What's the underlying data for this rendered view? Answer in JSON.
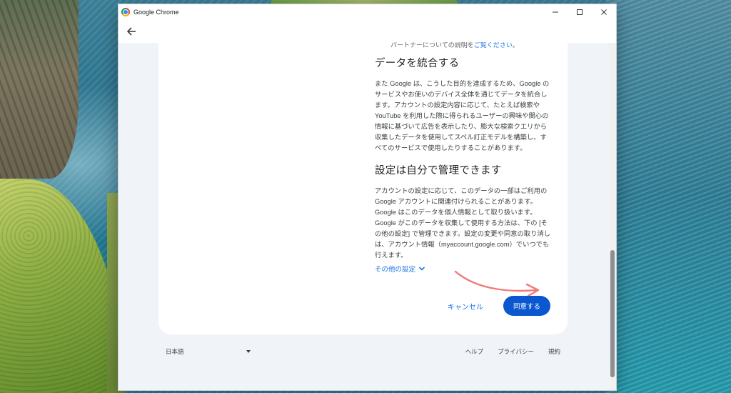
{
  "window": {
    "title": "Google Chrome",
    "controls": {
      "minimize": "—",
      "maximize": "☐",
      "close": "✕"
    }
  },
  "consent": {
    "cut_line_text": "パートナーについての説明を",
    "cut_line_link": "ご覧ください",
    "cut_line_tail": "。",
    "section1_title": "データを統合する",
    "section1_body": "また Google は、こうした目的を達成するため、Google のサービスやお使いのデバイス全体を通じてデータを統合します。アカウントの設定内容に応じて、たとえば検索や YouTube を利用した際に得られるユーザーの興味や関心の情報に基づいて広告を表示したり、膨大な検索クエリから収集したデータを使用してスペル訂正モデルを構築し、すべてのサービスで使用したりすることがあります。",
    "section2_title": "設定は自分で管理できます",
    "section2_body": "アカウントの設定に応じて、このデータの一部はご利用の Google アカウントに関連付けられることがあります。Google はこのデータを個人情報として取り扱います。Google がこのデータを収集して使用する方法は、下の [その他の設定] で管理できます。設定の変更や同意の取り消しは、アカウント情報（myaccount.google.com）でいつでも行えます。",
    "more_settings": "その他の設定",
    "cancel_label": "キャンセル",
    "agree_label": "同意する"
  },
  "footer": {
    "language": "日本語",
    "links": [
      "ヘルプ",
      "プライバシー",
      "規約"
    ]
  },
  "colors": {
    "link": "#1a73e8",
    "primary_button": "#0b57d0",
    "annotation_arrow": "#f07a7a"
  },
  "icons": {
    "back": "arrow-left-icon",
    "chevron": "chevron-down-icon",
    "dropdown": "caret-down-icon"
  }
}
